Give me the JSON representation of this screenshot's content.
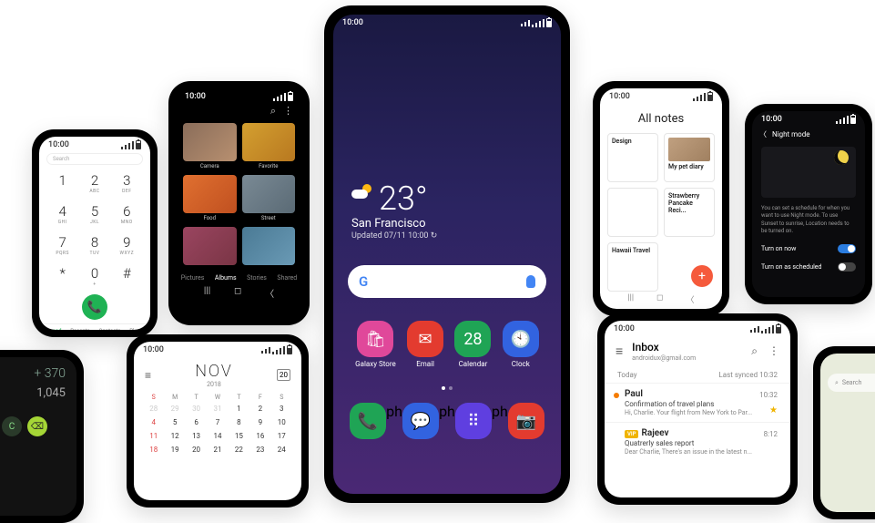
{
  "main": {
    "time": "10:00",
    "weather": {
      "temp": "23°",
      "city": "San Francisco",
      "updated": "Updated 07/11 10:00"
    },
    "apps_row1": [
      {
        "label": "Galaxy Store",
        "color": "#e0489a",
        "glyph": "🛍"
      },
      {
        "label": "Email",
        "color": "#e33b2f",
        "glyph": "✉"
      },
      {
        "label": "Calendar",
        "color": "#1fa455",
        "glyph": "28"
      },
      {
        "label": "Clock",
        "color": "#3263e0",
        "glyph": "🕙"
      }
    ],
    "apps_row2": [
      {
        "label": "",
        "color": "#1fa455",
        "glyph": "📞"
      },
      {
        "label": "",
        "color": "#3263e0",
        "glyph": "💬"
      },
      {
        "label": "",
        "color": "#5f3fe0",
        "glyph": "⠿"
      },
      {
        "label": "",
        "color": "#e33b2f",
        "glyph": "📷"
      }
    ]
  },
  "dialer": {
    "time": "10:00",
    "search": "Search",
    "keys": [
      {
        "n": "1",
        "l": ""
      },
      {
        "n": "2",
        "l": "ABC"
      },
      {
        "n": "3",
        "l": "DEF"
      },
      {
        "n": "4",
        "l": "GHI"
      },
      {
        "n": "5",
        "l": "JKL"
      },
      {
        "n": "6",
        "l": "MNO"
      },
      {
        "n": "7",
        "l": "PQRS"
      },
      {
        "n": "8",
        "l": "TUV"
      },
      {
        "n": "9",
        "l": "WXYZ"
      },
      {
        "n": "*",
        "l": ""
      },
      {
        "n": "0",
        "l": "+"
      },
      {
        "n": "#",
        "l": ""
      }
    ],
    "tabs": [
      "Keypad",
      "Recents",
      "Contacts",
      "Places"
    ]
  },
  "gallery": {
    "time": "10:00",
    "items": [
      {
        "cap": "Camera",
        "bg": "linear-gradient(135deg,#8a6d5a,#b89070)"
      },
      {
        "cap": "Favorite",
        "bg": "linear-gradient(135deg,#d4a030,#b87820)"
      },
      {
        "cap": "Food",
        "bg": "linear-gradient(135deg,#e07030,#c05020)"
      },
      {
        "cap": "Street",
        "bg": "linear-gradient(135deg,#7a8a95,#5a6a75)"
      },
      {
        "cap": "",
        "bg": "linear-gradient(135deg,#9a4560,#7a3545)"
      },
      {
        "cap": "",
        "bg": "linear-gradient(135deg,#4a7a95,#6a9ab5)"
      }
    ],
    "tabs": [
      "Pictures",
      "Albums",
      "Stories",
      "Shared"
    ]
  },
  "calc": {
    "line1": "+ 370",
    "line2": "1,045"
  },
  "calendar": {
    "time": "10:00",
    "month": "NOV",
    "year": "2018",
    "day_badge": "20",
    "dow": [
      "S",
      "M",
      "T",
      "W",
      "T",
      "F",
      "S"
    ],
    "grid": [
      "28",
      "29",
      "30",
      "31",
      "1",
      "2",
      "3",
      "4",
      "5",
      "6",
      "7",
      "8",
      "9",
      "10",
      "11",
      "12",
      "13",
      "14",
      "15",
      "16",
      "17",
      "18",
      "19",
      "20",
      "21",
      "22",
      "23",
      "24"
    ]
  },
  "notes": {
    "time": "10:00",
    "title": "All notes",
    "cards": [
      {
        "t": "Design",
        "b": ""
      },
      {
        "t": "My pet diary",
        "b": "",
        "thumb": "linear-gradient(135deg,#c0a080,#a08060)"
      },
      {
        "t": "",
        "b": ""
      },
      {
        "t": "Strawberry Pancake Reci...",
        "b": ""
      },
      {
        "t": "Hawaii Travel",
        "b": ""
      }
    ]
  },
  "night": {
    "title": "Night mode",
    "desc": "You can set a schedule for when you want to use Night mode. To use Sunset to sunrise, Location needs to be turned on.",
    "t1": "Turn on now",
    "t2": "Turn on as scheduled"
  },
  "mail": {
    "time": "10:00",
    "title": "Inbox",
    "account": "androidux@gmail.com",
    "section": "Today",
    "synced": "Last synced 10:32",
    "items": [
      {
        "from": "Paul",
        "subj": "Confirmation of travel plans",
        "prev": "Hi, Charlie. Your flight from New York to Par...",
        "time": "10:32",
        "dot": "#f57c00",
        "star": true
      },
      {
        "from": "Rajeev",
        "subj": "Quatrerly sales report",
        "prev": "Dear Charlie, There's an issue in the latest n...",
        "time": "8:12",
        "dot": "",
        "vip": true
      }
    ]
  },
  "maps": {
    "search": "Search"
  }
}
